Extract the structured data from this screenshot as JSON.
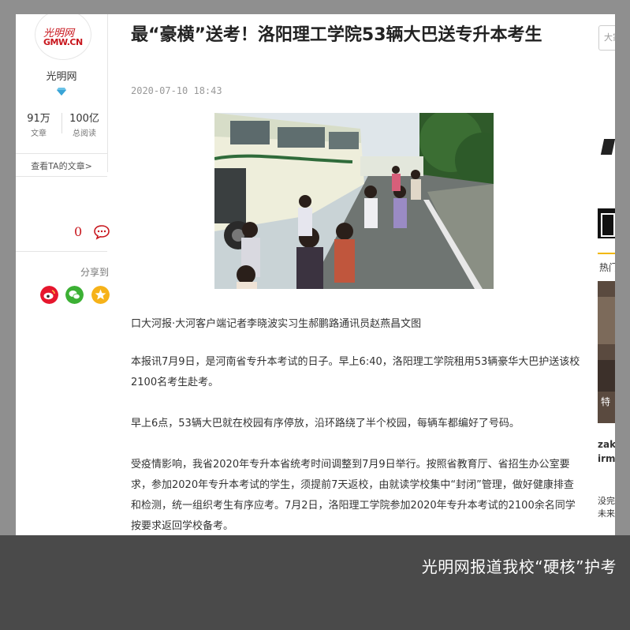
{
  "sidebar": {
    "logo_text_top": "光明网",
    "logo_text_bottom": "GMW.CN",
    "author_name": "光明网",
    "stats": [
      {
        "value": "91万",
        "label": "文章"
      },
      {
        "value": "100亿",
        "label": "总阅读"
      }
    ],
    "view_articles": "查看TA的文章>",
    "comment_count": "0",
    "share_label": "分享到"
  },
  "article": {
    "title": "最“豪横”送考！洛阳理工学院53辆大巴送专升本考生",
    "date": "2020-07-10 18:43",
    "paragraphs": [
      "口大河报·大河客户端记者李晓波实习生郝鹏路通讯员赵燕昌文图",
      "本报讯7月9日，是河南省专升本考试的日子。早上6:40，洛阳理工学院租用53辆豪华大巴护送该校2100名考生赴考。",
      "早上6点，53辆大巴就在校园有序停放，沿环路绕了半个校园，每辆车都编好了号码。",
      "受疫情影响，我省2020年专升本省统考时间调整到7月9日举行。按照省教育厅、省招生办公室要求，参加2020年专升本考试的学生，须提前7天返校，由就读学校集中“封闭”管理，做好健康排查和检测，统一组织考生有序应考。7月2日，洛阳理工学院参加2020年专升本考试的2100余名同学按要求返回学校备考。"
    ]
  },
  "right_column": {
    "search_placeholder": "大家都在搜",
    "hot_label": "热门",
    "texts": [
      "特",
      "zak",
      "irm",
      "没完",
      "未来"
    ]
  },
  "caption": "光明网报道我校“硬核”护考",
  "colors": {
    "brand_red": "#c8161d",
    "weibo": "#e6162d",
    "wechat": "#3cb034",
    "favorite": "#f6b219",
    "bar": "#4a4a4a"
  }
}
